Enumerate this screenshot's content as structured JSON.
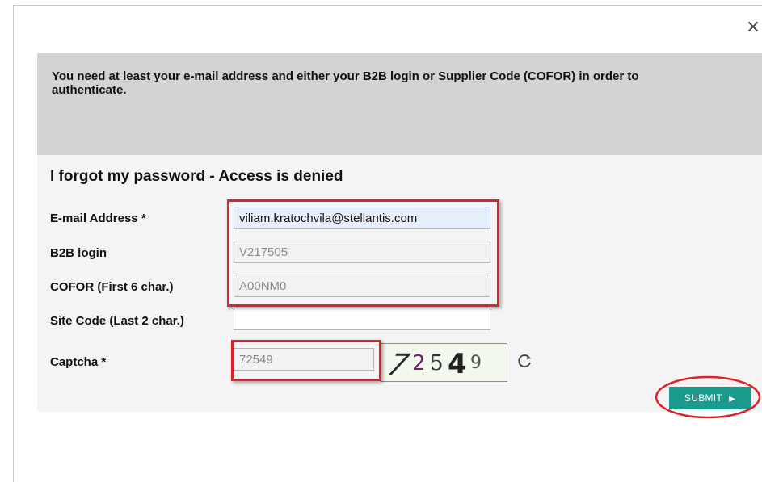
{
  "dialog": {
    "close_label": "×",
    "notice": "You need at least your e-mail address and either your B2B login or Supplier Code (COFOR) in order to authenticate.",
    "title": "I forgot my password - Access is denied"
  },
  "form": {
    "email": {
      "label": "E-mail Address *",
      "value": "viliam.kratochvila@stellantis.com"
    },
    "b2b": {
      "label": "B2B login",
      "value": "V217505"
    },
    "cofor": {
      "label": "COFOR (First 6 char.)",
      "value": "A00NM0"
    },
    "site": {
      "label": "Site Code (Last 2 char.)",
      "value": ""
    },
    "captcha": {
      "label": "Captcha *",
      "value": "72549"
    }
  },
  "captcha_image": {
    "chars": [
      "7",
      "2",
      "5",
      "4",
      "9"
    ],
    "colors": [
      "#2a2a2a",
      "#7a1f6e",
      "#333333",
      "#222222",
      "#555555"
    ]
  },
  "submit": {
    "label": "SUBMIT",
    "color": "#1a9a8c"
  },
  "annotation_color": "#e0202a"
}
